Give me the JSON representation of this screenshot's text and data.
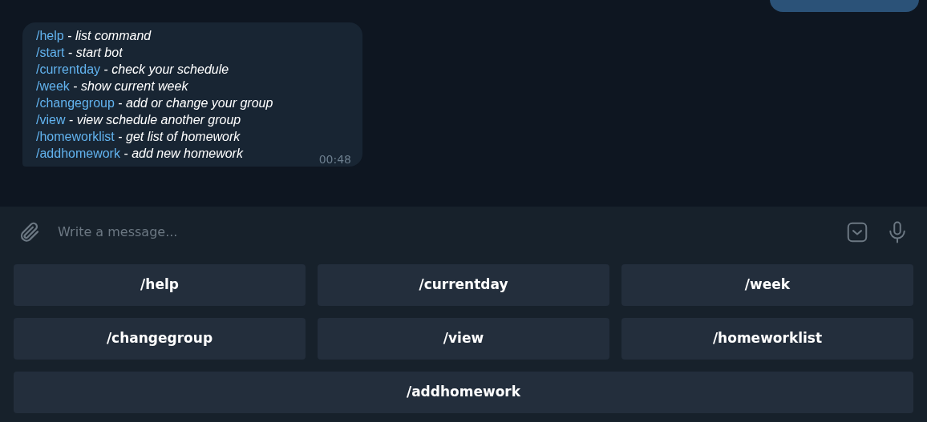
{
  "message": {
    "lines": [
      {
        "command": "/help",
        "description": "- *list command*"
      },
      {
        "command": "/start",
        "description": "- *start bot*"
      },
      {
        "command": "/currentday",
        "description": "- *check your schedule*"
      },
      {
        "command": "/week",
        "description": "- *show current week*"
      },
      {
        "command": "/changegroup",
        "description": "- *add or change your group*"
      },
      {
        "command": "/view",
        "description": "- *view schedule another group*"
      },
      {
        "command": "/homeworklist",
        "description": "- *get list of homework*"
      },
      {
        "command": "/addhomework",
        "description": "- *add new homework*"
      }
    ],
    "time": "00:48"
  },
  "composer": {
    "placeholder": "Write a message..."
  },
  "keyboard": {
    "button_rows": [
      {
        "buttons": [
          "/help",
          "/currentday",
          "/week"
        ]
      },
      {
        "buttons": [
          "/changegroup",
          "/view",
          "/homeworklist"
        ]
      },
      {
        "buttons": [
          "/addhomework"
        ]
      }
    ]
  }
}
